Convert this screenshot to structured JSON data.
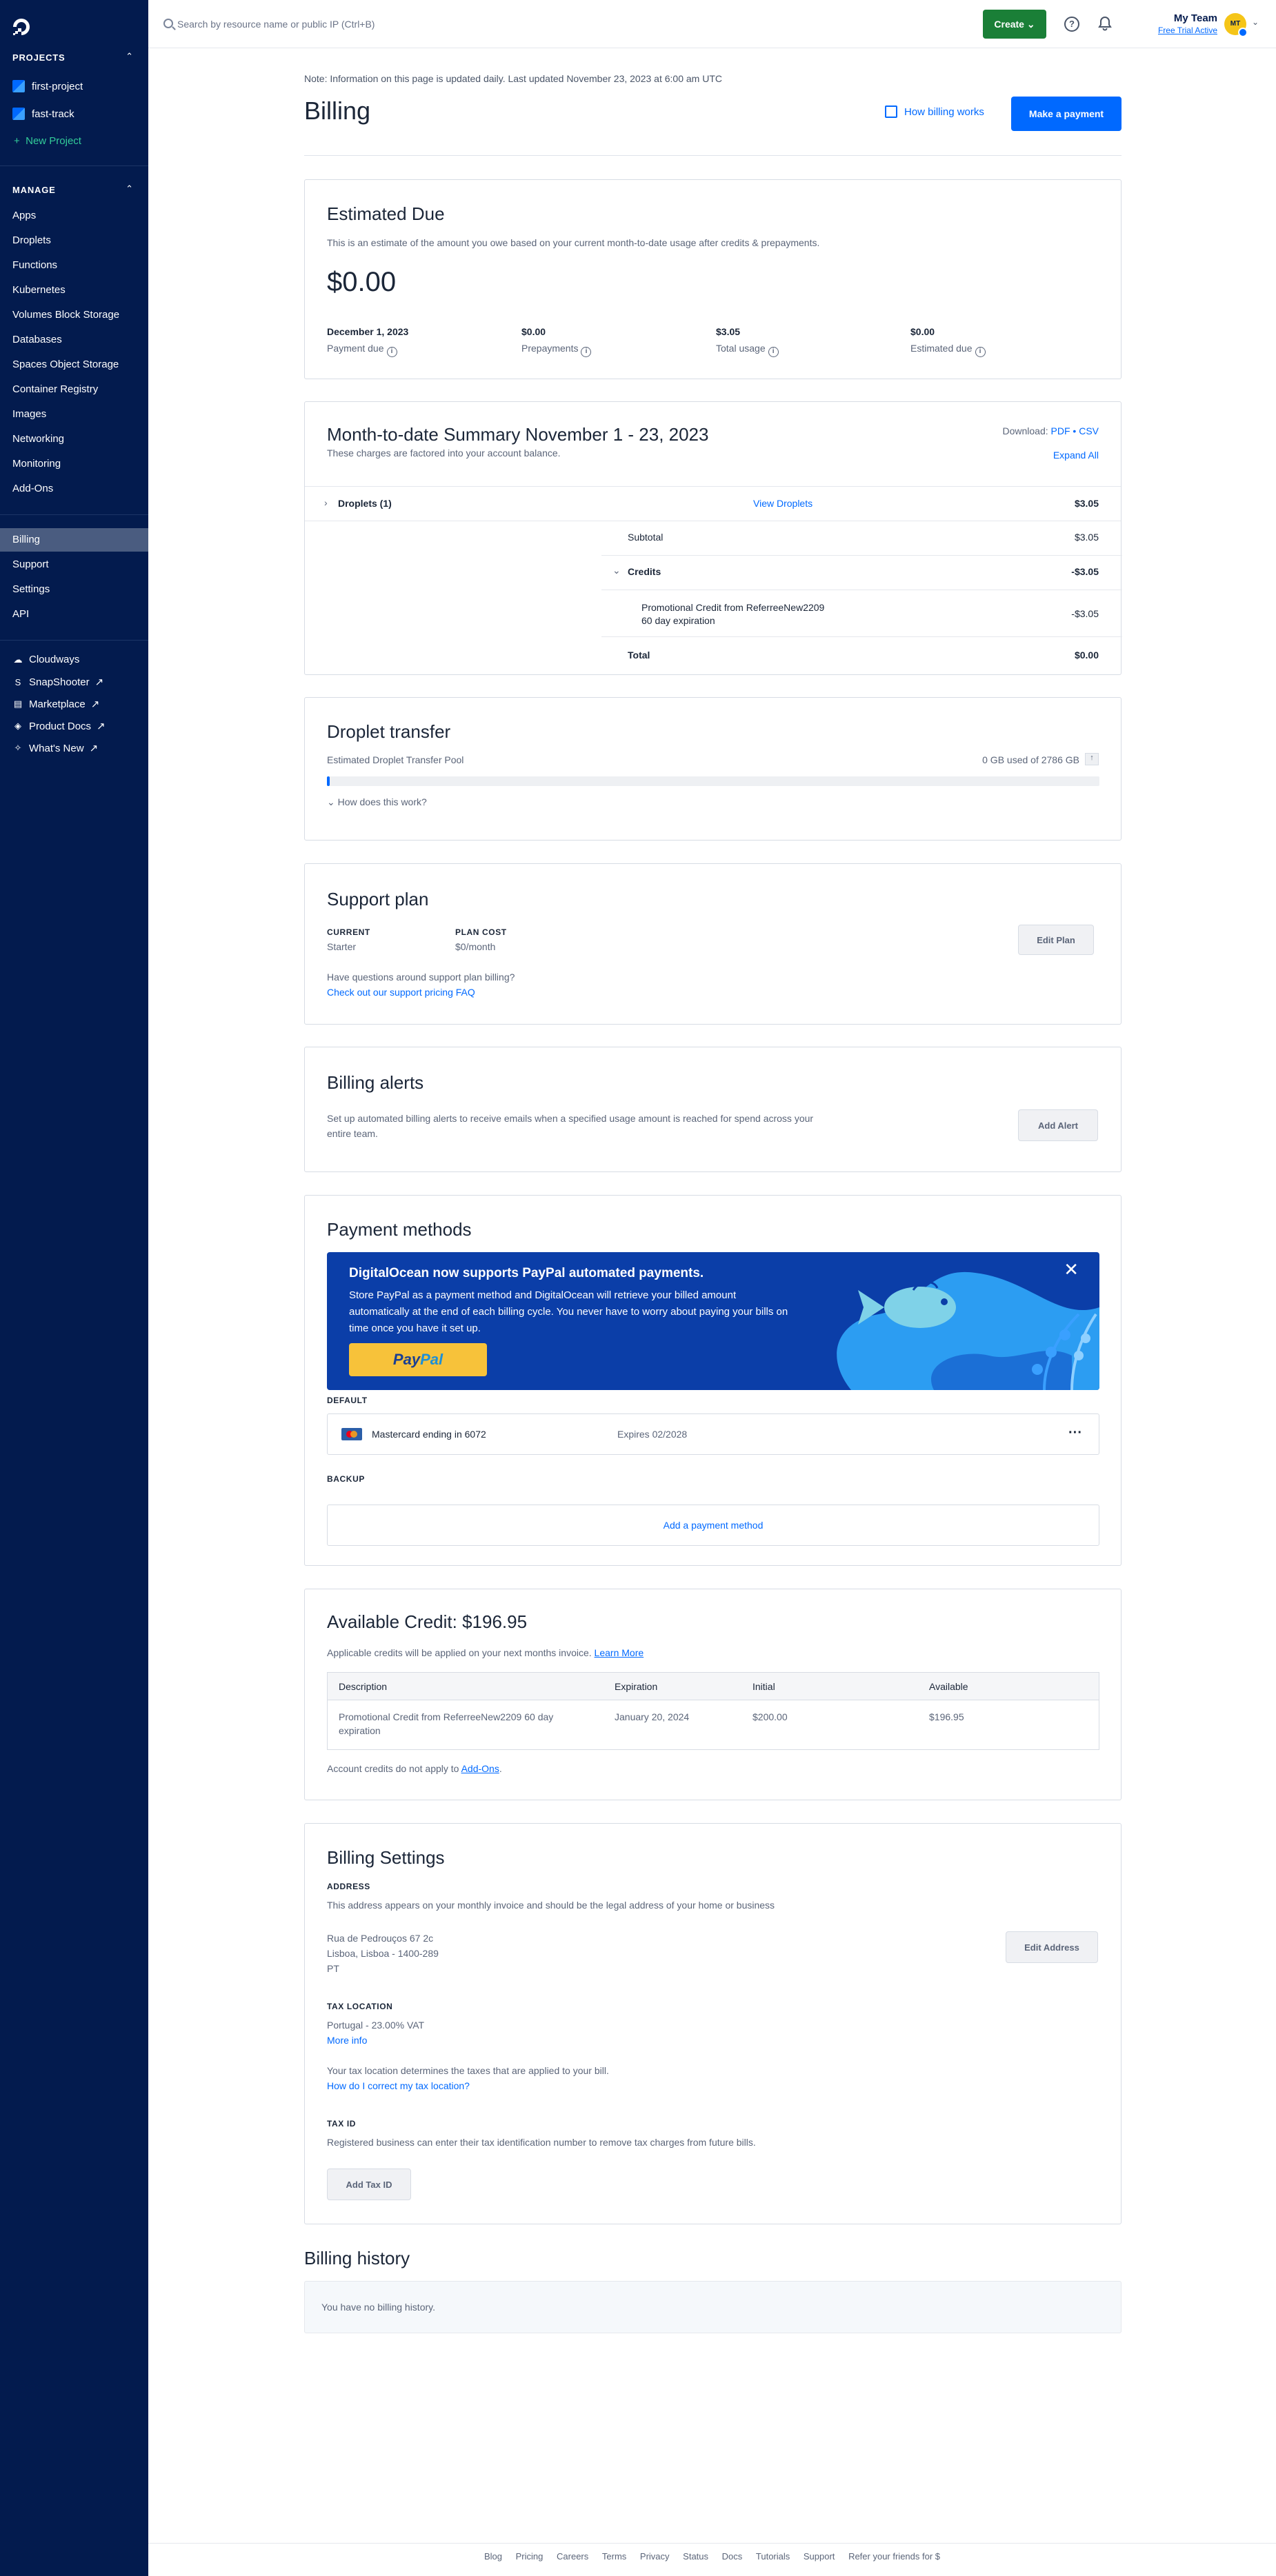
{
  "sidebar": {
    "projects_heading": "PROJECTS",
    "projects": [
      {
        "label": "first-project"
      },
      {
        "label": "fast-track"
      }
    ],
    "new_project": "New Project",
    "manage_heading": "MANAGE",
    "manage_items": [
      "Apps",
      "Droplets",
      "Functions",
      "Kubernetes",
      "Volumes Block Storage",
      "Databases",
      "Spaces Object Storage",
      "Container Registry",
      "Images",
      "Networking",
      "Monitoring",
      "Add-Ons"
    ],
    "account_items": [
      "Billing",
      "Support",
      "Settings",
      "API"
    ],
    "active_item": "Billing",
    "external_items": [
      "Cloudways",
      "SnapShooter",
      "Marketplace",
      "Product Docs",
      "What's New"
    ]
  },
  "topbar": {
    "search_placeholder": "Search by resource name or public IP (Ctrl+B)",
    "create_label": "Create",
    "team_name": "My Team",
    "team_status": "Free Trial Active",
    "avatar_initials": "MT"
  },
  "header": {
    "note": "Note: Information on this page is updated daily. Last updated November 23, 2023 at 6:00 am UTC",
    "title": "Billing",
    "how_billing_works": "How billing works",
    "make_payment": "Make a payment"
  },
  "estimated_due": {
    "title": "Estimated Due",
    "description": "This is an estimate of the amount you owe based on your current month-to-date usage after credits & prepayments.",
    "amount": "$0.00",
    "stats": [
      {
        "value": "December 1, 2023",
        "label": "Payment due"
      },
      {
        "value": "$0.00",
        "label": "Prepayments"
      },
      {
        "value": "$3.05",
        "label": "Total usage"
      },
      {
        "value": "$0.00",
        "label": "Estimated due"
      }
    ]
  },
  "summary": {
    "title": "Month-to-date Summary November 1 - 23, 2023",
    "subtitle": "These charges are factored into your account balance.",
    "download_label": "Download:",
    "pdf": "PDF",
    "sep": "•",
    "csv": "CSV",
    "expand_all": "Expand All",
    "droplets_label": "Droplets (1)",
    "view_droplets": "View Droplets",
    "droplets_amount": "$3.05",
    "subtotal_label": "Subtotal",
    "subtotal_amount": "$3.05",
    "credits_label": "Credits",
    "credits_amount": "-$3.05",
    "promo_line1": "Promotional Credit from ReferreeNew2209",
    "promo_line2": "60 day expiration",
    "promo_amount": "-$3.05",
    "total_label": "Total",
    "total_amount": "$0.00"
  },
  "transfer": {
    "title": "Droplet transfer",
    "pool_label": "Estimated Droplet Transfer Pool",
    "usage": "0 GB used of 2786 GB",
    "usage_fraction": 0.0,
    "how": "How does this work?"
  },
  "support": {
    "title": "Support plan",
    "current_label": "CURRENT",
    "current_value": "Starter",
    "cost_label": "PLAN COST",
    "cost_value": "$0/month",
    "question": "Have questions around support plan billing?",
    "faq_link": "Check out our support pricing FAQ",
    "edit_plan": "Edit Plan"
  },
  "alerts": {
    "title": "Billing alerts",
    "description": "Set up automated billing alerts to receive emails when a specified usage amount is reached for spend across your entire team.",
    "add_alert": "Add Alert"
  },
  "payment": {
    "title": "Payment methods",
    "banner_title": "DigitalOcean now supports PayPal automated payments.",
    "banner_body": "Store PayPal as a payment method and DigitalOcean will retrieve your billed amount automatically at the end of each billing cycle. You never have to worry about paying your bills on time once you have it set up.",
    "paypal_a": "Pay",
    "paypal_b": "Pal",
    "default_label": "DEFAULT",
    "card_label": "Mastercard ending in 6072",
    "card_expiry": "Expires 02/2028",
    "backup_label": "BACKUP",
    "add_method": "Add a payment method"
  },
  "credit": {
    "title": "Available Credit: $196.95",
    "note": "Applicable credits will be applied on your next months invoice.",
    "learn_more": "Learn More",
    "columns": [
      "Description",
      "Expiration",
      "Initial",
      "Available"
    ],
    "row": {
      "description_line1": "Promotional Credit from ReferreeNew2209 60 day",
      "description_line2": "expiration",
      "expiration": "January 20, 2024",
      "initial": "$200.00",
      "available": "$196.95"
    },
    "footnote": "Account credits do not apply to",
    "footnote_link": "Add-Ons",
    "footnote_end": "."
  },
  "settings": {
    "title": "Billing Settings",
    "address_label": "ADDRESS",
    "address_desc": "This address appears on your monthly invoice and should be the legal address of your home or business",
    "address_lines": [
      "Rua de Pedrouços 67 2c",
      "Lisboa, Lisboa - 1400-289",
      "PT"
    ],
    "edit_address": "Edit Address",
    "tax_location_label": "TAX LOCATION",
    "tax_location_value": "Portugal - 23.00% VAT",
    "more_info": "More info",
    "tax_desc": "Your tax location determines the taxes that are applied to your bill.",
    "tax_link": "How do I correct my tax location?",
    "tax_id_label": "TAX ID",
    "tax_id_desc": "Registered business can enter their tax identification number to remove tax charges from future bills.",
    "add_tax_id": "Add Tax ID"
  },
  "history": {
    "title": "Billing history",
    "empty": "You have no billing history."
  },
  "footer": {
    "links": [
      "Blog",
      "Pricing",
      "Careers",
      "Terms",
      "Privacy",
      "Status",
      "Docs",
      "Tutorials",
      "Support",
      "Refer your friends for $"
    ]
  },
  "colors": {
    "sidebar": "#031b4e",
    "primary": "#0069ff",
    "create_green": "#1a7f37",
    "new_project_green": "#33cc99",
    "banner_blue": "#0b3ea8",
    "paypal_yellow": "#f7c23a"
  }
}
